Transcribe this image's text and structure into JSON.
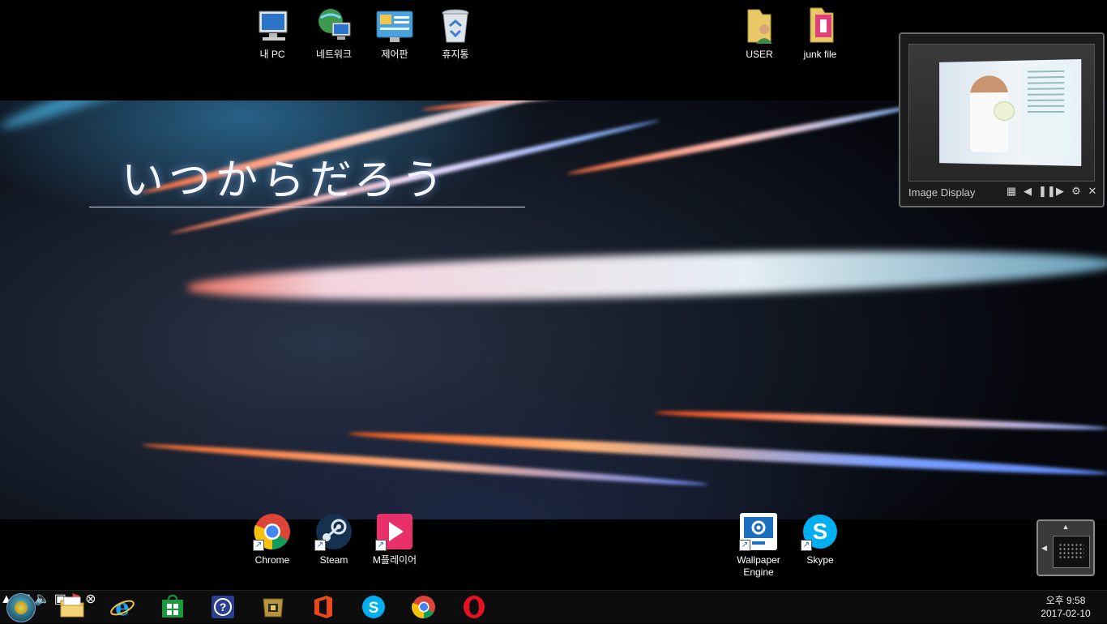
{
  "wallpaper": {
    "title": "いつからだろう"
  },
  "desktop_top": [
    {
      "label": "내 PC",
      "icon": "computer-icon"
    },
    {
      "label": "네트워크",
      "icon": "network-icon"
    },
    {
      "label": "제어판",
      "icon": "control-panel-icon"
    },
    {
      "label": "휴지통",
      "icon": "recycle-bin-icon"
    },
    {
      "label": "USER",
      "icon": "user-folder-icon"
    },
    {
      "label": "junk file",
      "icon": "folder-icon"
    }
  ],
  "desktop_bottom": [
    {
      "label": "Chrome",
      "icon": "chrome-icon"
    },
    {
      "label": "Steam",
      "icon": "steam-icon"
    },
    {
      "label": "M플레이어",
      "icon": "mplayer-icon"
    },
    {
      "label": "Wallpaper Engine",
      "line1": "Wallpaper",
      "line2": "Engine",
      "icon": "wallpaper-engine-icon"
    },
    {
      "label": "Skype",
      "icon": "skype-icon"
    }
  ],
  "gadget": {
    "title": "Image Display",
    "controls": [
      "grid-icon",
      "previous-icon",
      "pause-icon",
      "next-icon",
      "settings-icon",
      "close-icon"
    ]
  },
  "taskbar": {
    "pinned": [
      "file-explorer-icon",
      "internet-explorer-icon",
      "store-icon",
      "help-icon",
      "game-icon",
      "office-icon",
      "skype-icon",
      "chrome-icon",
      "opera-icon"
    ],
    "tray": [
      "show-hidden-icons",
      "device-icon",
      "volume-icon",
      "network-icon",
      "action-center-icon",
      "close-circle-icon"
    ],
    "clock": {
      "time": "오후 9:58",
      "date": "2017-02-10"
    }
  },
  "colors": {
    "taskbar": "#0d0d0d",
    "gadget_border": "#6b6b6b",
    "desktop": "#000000"
  }
}
